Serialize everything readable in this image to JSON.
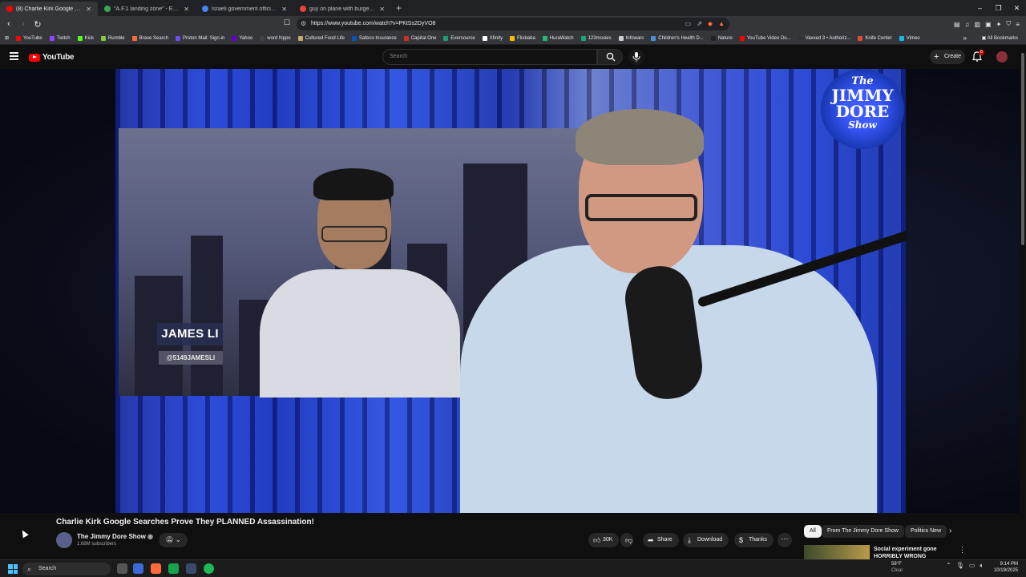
{
  "browser": {
    "tabs": [
      {
        "label": "(8) Charlie Kirk Google Searc",
        "active": true,
        "color": "#ff0000"
      },
      {
        "label": "\"A.F.1 landing zone\" - Explore - Goo",
        "active": false,
        "color": "#34a853"
      },
      {
        "label": "Israeli government official charged w",
        "active": false,
        "color": "#4285f4"
      },
      {
        "label": "guy on plane with burger king hat - ",
        "active": false,
        "color": "#ea4335"
      }
    ],
    "url": "https://www.youtube.com/watch?v=PKtSs2DyVO8",
    "bookmarks": [
      {
        "label": "YouTube",
        "color": "#ff0000"
      },
      {
        "label": "Twitch",
        "color": "#9146ff"
      },
      {
        "label": "Kick",
        "color": "#53fc18"
      },
      {
        "label": "Rumble",
        "color": "#85c742"
      },
      {
        "label": "Brave Search",
        "color": "#ff6b3d"
      },
      {
        "label": "Proton Mail: Sign-in",
        "color": "#6d4aff"
      },
      {
        "label": "Yahoo",
        "color": "#6001d2"
      },
      {
        "label": "word hippo",
        "color": "#444444"
      },
      {
        "label": "Cultured Food Life",
        "color": "#c9a96e"
      },
      {
        "label": "Safeco Insurance",
        "color": "#0057b8"
      },
      {
        "label": "Capital One",
        "color": "#d03027"
      },
      {
        "label": "Eversource",
        "color": "#1b9e77"
      },
      {
        "label": "Xfinity",
        "color": "#ffffff"
      },
      {
        "label": "Flixbaba",
        "color": "#f2c200"
      },
      {
        "label": "HuraWatch",
        "color": "#2bb673"
      },
      {
        "label": "123movies",
        "color": "#19a974"
      },
      {
        "label": "Infowars",
        "color": "#cccccc"
      },
      {
        "label": "Children's Health D...",
        "color": "#4a90d9"
      },
      {
        "label": "Nature",
        "color": "#222222"
      },
      {
        "label": "YouTube Video Do...",
        "color": "#ff0000"
      },
      {
        "label": "Vaxxed 3 • Authoriz...",
        "color": "#333333"
      },
      {
        "label": "Knife Center",
        "color": "#e34a33"
      },
      {
        "label": "Vimeo",
        "color": "#1ab7ea"
      }
    ],
    "all_bookmarks": "All Bookmarks"
  },
  "youtube": {
    "logo_text": "YouTube",
    "search_placeholder": "Search",
    "create_label": "Create",
    "notif_count": "8"
  },
  "video": {
    "overlay_name": "JAMES LI",
    "overlay_handle": "@5149JAMESLI",
    "logo_lines": [
      "The",
      "JIMMY",
      "DORE",
      "Show"
    ],
    "title": "Charlie Kirk Google Searches Prove They PLANNED Assassination!",
    "channel_name": "The Jimmy Dore Show",
    "subscribers": "1.66M subscribers",
    "likes": "30K",
    "share": "Share",
    "download": "Download",
    "thanks": "Thanks"
  },
  "sidebar": {
    "chips": [
      "All",
      "From The Jimmy Dore Show",
      "Politics New"
    ],
    "rec_title": "Social experiment gone HORRIBLY WRONG"
  },
  "taskbar": {
    "search": "Search",
    "temperature": "58°F",
    "weather": "Clear",
    "time": "9:14 PM",
    "date": "10/19/2025"
  }
}
